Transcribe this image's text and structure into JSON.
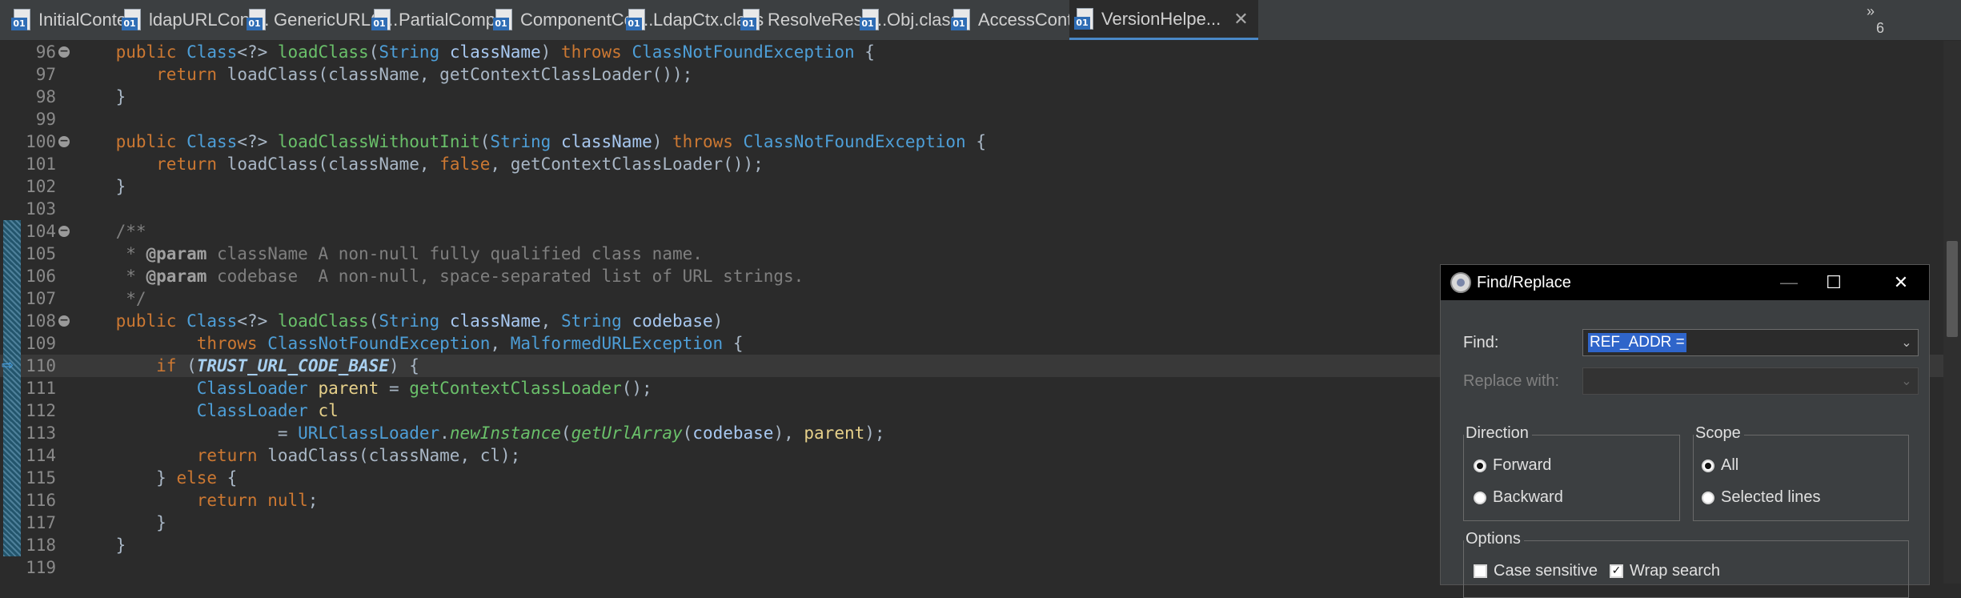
{
  "tabs": [
    {
      "label": "InitialConte...",
      "active": false
    },
    {
      "label": "ldapURLCont...",
      "active": false
    },
    {
      "label": "GenericURLC...",
      "active": false
    },
    {
      "label": "PartialComp...",
      "active": false
    },
    {
      "label": "ComponentCon...",
      "active": false
    },
    {
      "label": "LdapCtx.class",
      "active": false
    },
    {
      "label": "ResolveResu...",
      "active": false
    },
    {
      "label": "Obj.class",
      "active": false
    },
    {
      "label": "AccessContr...",
      "active": false
    },
    {
      "label": "VersionHelpe...",
      "active": true
    }
  ],
  "tab_icon_text": "01",
  "tab_close_glyph": "✕",
  "overflow": {
    "glyph": "»",
    "count": "6"
  },
  "editor": {
    "current_line": "110",
    "lines": [
      {
        "n": "96",
        "fold": true,
        "segs": [
          [
            "",
            "    "
          ],
          [
            "kw",
            "public "
          ],
          [
            "ty",
            "Class"
          ],
          [
            "",
            "<?> "
          ],
          [
            "fn",
            "loadClass"
          ],
          [
            "",
            "("
          ],
          [
            "ty",
            "String "
          ],
          [
            "pm",
            "className"
          ],
          [
            "",
            ") "
          ],
          [
            "kw",
            "throws "
          ],
          [
            "ty",
            "ClassNotFoundException"
          ],
          [
            "",
            " {"
          ]
        ]
      },
      {
        "n": "97",
        "segs": [
          [
            "",
            "        "
          ],
          [
            "kw",
            "return "
          ],
          [
            "",
            "loadClass(className, getContextClassLoader());"
          ]
        ]
      },
      {
        "n": "98",
        "segs": [
          [
            "",
            "    }"
          ]
        ]
      },
      {
        "n": "99",
        "segs": []
      },
      {
        "n": "100",
        "fold": true,
        "segs": [
          [
            "",
            "    "
          ],
          [
            "kw",
            "public "
          ],
          [
            "ty",
            "Class"
          ],
          [
            "",
            "<?> "
          ],
          [
            "fn",
            "loadClassWithoutInit"
          ],
          [
            "",
            "("
          ],
          [
            "ty",
            "String "
          ],
          [
            "pm",
            "className"
          ],
          [
            "",
            ") "
          ],
          [
            "kw",
            "throws "
          ],
          [
            "ty",
            "ClassNotFoundException"
          ],
          [
            "",
            " {"
          ]
        ]
      },
      {
        "n": "101",
        "segs": [
          [
            "",
            "        "
          ],
          [
            "kw",
            "return "
          ],
          [
            "",
            "loadClass(className, "
          ],
          [
            "kw",
            "false"
          ],
          [
            "",
            ", getContextClassLoader());"
          ]
        ]
      },
      {
        "n": "102",
        "segs": [
          [
            "",
            "    }"
          ]
        ]
      },
      {
        "n": "103",
        "segs": []
      },
      {
        "n": "104",
        "fold": true,
        "changed": true,
        "segs": [
          [
            "cm",
            "    /**"
          ]
        ]
      },
      {
        "n": "105",
        "changed": true,
        "segs": [
          [
            "cm",
            "     * "
          ],
          [
            "tag",
            "@param"
          ],
          [
            "cm",
            " className A non-null fully qualified class name."
          ]
        ]
      },
      {
        "n": "106",
        "changed": true,
        "segs": [
          [
            "cm",
            "     * "
          ],
          [
            "tag",
            "@param"
          ],
          [
            "cm",
            " codebase  A non-null, space-separated list of URL strings."
          ]
        ]
      },
      {
        "n": "107",
        "changed": true,
        "segs": [
          [
            "cm",
            "     */"
          ]
        ]
      },
      {
        "n": "108",
        "fold": true,
        "changed": true,
        "segs": [
          [
            "",
            "    "
          ],
          [
            "kw",
            "public "
          ],
          [
            "ty",
            "Class"
          ],
          [
            "",
            "<?> "
          ],
          [
            "fn",
            "loadClass"
          ],
          [
            "",
            "("
          ],
          [
            "ty",
            "String "
          ],
          [
            "pm",
            "className"
          ],
          [
            "",
            ", "
          ],
          [
            "ty",
            "String "
          ],
          [
            "pm",
            "codebase"
          ],
          [
            "",
            ")"
          ]
        ]
      },
      {
        "n": "109",
        "changed": true,
        "segs": [
          [
            "",
            "            "
          ],
          [
            "kw",
            "throws "
          ],
          [
            "ty",
            "ClassNotFoundException"
          ],
          [
            "",
            ", "
          ],
          [
            "ty",
            "MalformedURLException"
          ],
          [
            "",
            " {"
          ]
        ]
      },
      {
        "n": "110",
        "changed": true,
        "current": true,
        "segs": [
          [
            "",
            "        "
          ],
          [
            "kw",
            "if "
          ],
          [
            "",
            "("
          ],
          [
            "st",
            "TRUST_URL_CODE_BASE"
          ],
          [
            "",
            ") {"
          ]
        ]
      },
      {
        "n": "111",
        "changed": true,
        "segs": [
          [
            "",
            "            "
          ],
          [
            "ty",
            "ClassLoader "
          ],
          [
            "lv",
            "parent"
          ],
          [
            "",
            " = "
          ],
          [
            "fn",
            "getContextClassLoader"
          ],
          [
            "",
            "();"
          ]
        ]
      },
      {
        "n": "112",
        "changed": true,
        "segs": [
          [
            "",
            "            "
          ],
          [
            "ty",
            "ClassLoader "
          ],
          [
            "lv",
            "cl"
          ]
        ]
      },
      {
        "n": "113",
        "changed": true,
        "segs": [
          [
            "",
            "                    = "
          ],
          [
            "ty",
            "URLClassLoader"
          ],
          [
            "",
            "."
          ],
          [
            "it",
            "newInstance"
          ],
          [
            "",
            "("
          ],
          [
            "it",
            "getUrlArray"
          ],
          [
            "",
            "("
          ],
          [
            "pm",
            "codebase"
          ],
          [
            "",
            "), "
          ],
          [
            "lv",
            "parent"
          ],
          [
            "",
            ");"
          ]
        ]
      },
      {
        "n": "114",
        "changed": true,
        "segs": [
          [
            "",
            "            "
          ],
          [
            "kw",
            "return "
          ],
          [
            "",
            "loadClass(className, cl);"
          ]
        ]
      },
      {
        "n": "115",
        "changed": true,
        "segs": [
          [
            "",
            "        } "
          ],
          [
            "kw",
            "else "
          ],
          [
            "",
            "{"
          ]
        ]
      },
      {
        "n": "116",
        "changed": true,
        "segs": [
          [
            "",
            "            "
          ],
          [
            "kw",
            "return null"
          ],
          [
            "",
            ";"
          ]
        ]
      },
      {
        "n": "117",
        "changed": true,
        "segs": [
          [
            "",
            "        }"
          ]
        ]
      },
      {
        "n": "118",
        "changed": true,
        "segs": [
          [
            "",
            "    }"
          ]
        ]
      },
      {
        "n": "119",
        "segs": []
      }
    ]
  },
  "dialog": {
    "title": "Find/Replace",
    "minimize_glyph": "—",
    "maximize_glyph": "☐",
    "close_glyph": "✕",
    "find_label": "Find:",
    "find_value": "REF_ADDR =",
    "replace_label": "Replace with:",
    "replace_value": "",
    "direction": {
      "title": "Direction",
      "forward": "Forward",
      "backward": "Backward",
      "selected": "Forward"
    },
    "scope": {
      "title": "Scope",
      "all": "All",
      "selected_lines": "Selected lines",
      "selected": "All"
    },
    "options": {
      "title": "Options",
      "case_sensitive": "Case sensitive",
      "case_sensitive_checked": false,
      "wrap_search": "Wrap search",
      "wrap_search_checked": true
    }
  }
}
